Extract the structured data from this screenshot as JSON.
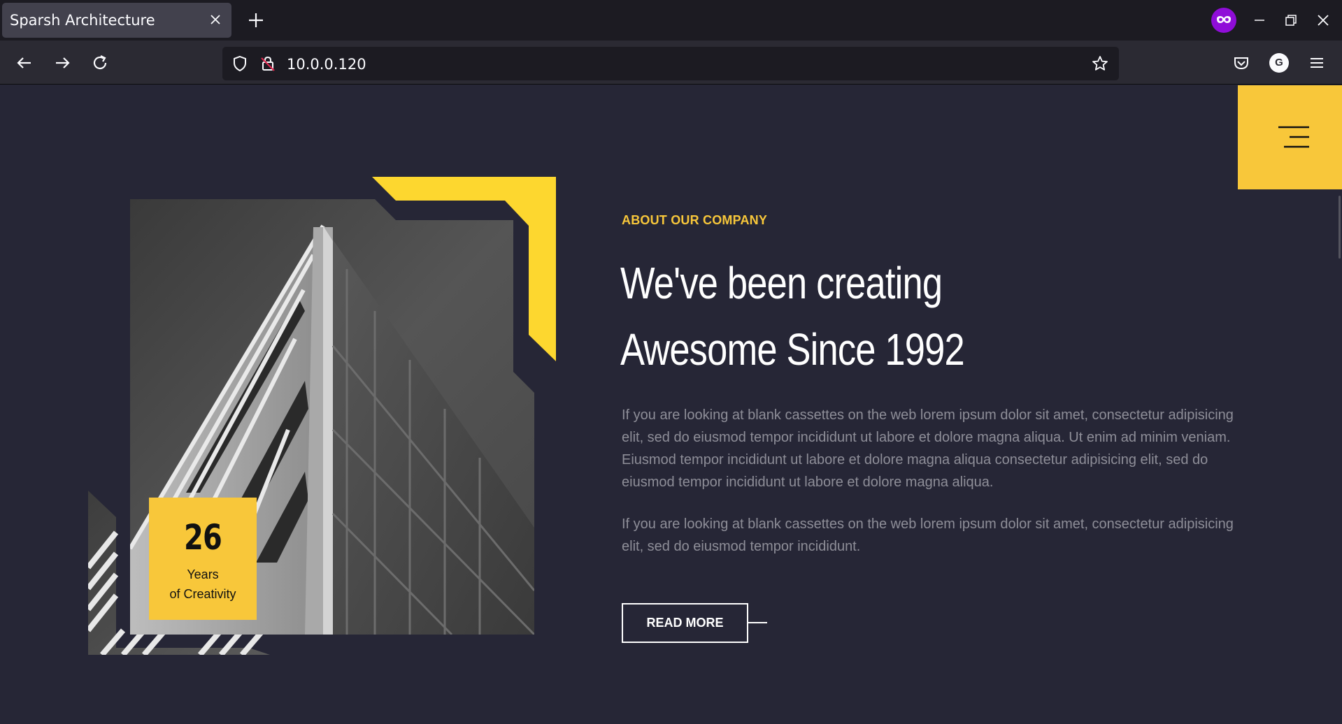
{
  "browser": {
    "tab_title": "Sparsh Architecture",
    "url": "10.0.0.120",
    "avatar_letter": "G"
  },
  "about": {
    "eyebrow": "ABOUT OUR COMPANY",
    "headline_line1": "We've been creating",
    "headline_line2": "Awesome Since 1992",
    "paragraph1": "If you are looking at blank cassettes on the web lorem ipsum dolor sit amet, consectetur adipisicing elit, sed do eiusmod tempor incididunt ut labore et dolore magna aliqua. Ut enim ad minim veniam. Eiusmod tempor incididunt ut labore et dolore magna aliqua consectetur adipisicing elit, sed do eiusmod tempor incididunt ut labore et dolore magna aliqua.",
    "paragraph2": "If you are looking at blank cassettes on the web lorem ipsum dolor sit amet, consectetur adipisicing elit, sed do eiusmod tempor incididunt.",
    "read_more_label": "READ MORE"
  },
  "years_badge": {
    "number": "26",
    "line1": "Years",
    "line2": "of Creativity"
  },
  "colors": {
    "accent": "#f8c73a",
    "background": "#262636",
    "body_text": "#8e8e98"
  }
}
